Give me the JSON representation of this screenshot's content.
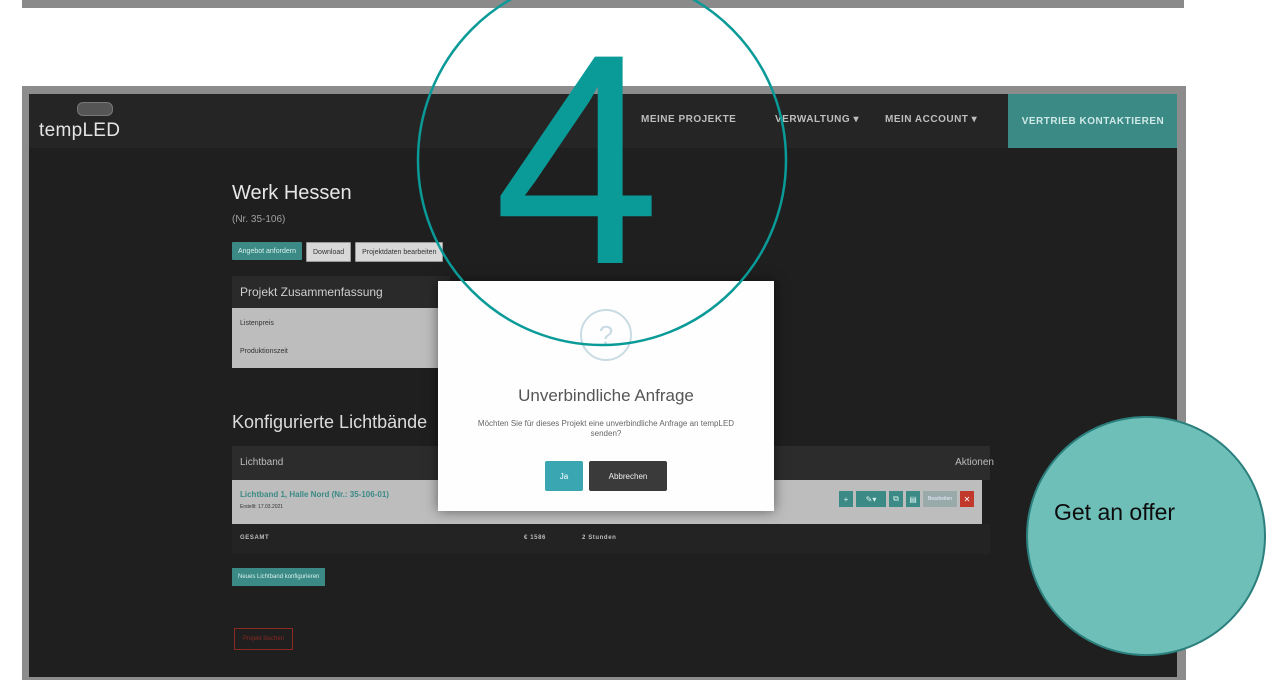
{
  "app": {
    "logo": "tempLED",
    "nav": [
      {
        "label": "MEINE PROJEKTE"
      },
      {
        "label": "VERWALTUNG ▾"
      },
      {
        "label": "MEIN ACCOUNT ▾"
      }
    ],
    "cta": "VERTRIEB KONTAKTIEREN"
  },
  "project": {
    "title": "Werk Hessen",
    "number": "(Nr. 35-106)",
    "buttons": [
      "Angebot anfordern",
      "Download",
      "Projektdaten bearbeiten"
    ]
  },
  "summary": {
    "title": "Projekt Zusammenfassung",
    "rows": [
      "Listenpreis",
      "Produktionszeit"
    ]
  },
  "section": {
    "title": "Konfigurierte Lichtbände"
  },
  "table": {
    "headers": {
      "name": "Lichtband",
      "actions": "Aktionen"
    },
    "row": {
      "title": "Lichtband 1, Halle Nord (Nr.: 35-106-01)",
      "sub": "Erstellt: 17.03.2021",
      "action_grey": "Bearbeiten"
    },
    "total": {
      "label": "GESAMT",
      "price": "€ 1586",
      "time": "2 Stunden"
    }
  },
  "new_button": "Neues Lichtband konfigurieren",
  "delete_button": "Projekt löschen",
  "modal": {
    "icon": "?",
    "title": "Unverbindliche Anfrage",
    "text": "Möchten Sie für dieses Projekt eine unverbindliche Anfrage an tempLED senden?",
    "yes": "Ja",
    "cancel": "Abbrechen"
  },
  "overlay": {
    "step": "4",
    "badge": "Get an offer"
  },
  "colors": {
    "accent": "#3b8a86",
    "overlay_teal": "#0a9a97",
    "badge_fill": "#6fbfb9"
  }
}
